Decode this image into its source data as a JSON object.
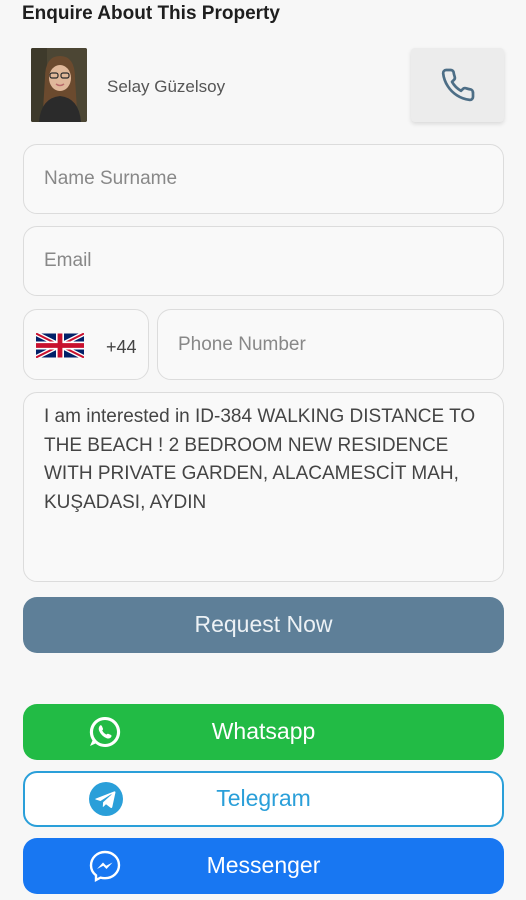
{
  "form": {
    "title": "Enquire About This Property"
  },
  "agent": {
    "name": "Selay Güzelsoy",
    "avatar_icon": "agent-photo",
    "call_icon": "phone-icon"
  },
  "fields": {
    "name_placeholder": "Name Surname",
    "email_placeholder": "Email",
    "country_flag_icon": "uk-flag-icon",
    "dial_code": "+44",
    "phone_placeholder": "Phone Number",
    "message_value": "I am interested in ID-384 WALKING DISTANCE TO THE BEACH ! 2 BEDROOM NEW RESIDENCE WITH PRIVATE GARDEN, ALACAMESCİT MAH, KUŞADASI, AYDIN"
  },
  "buttons": {
    "request_label": "Request Now",
    "whatsapp_label": "Whatsapp",
    "telegram_label": "Telegram",
    "messenger_label": "Messenger"
  },
  "colors": {
    "request": "#5e7f98",
    "whatsapp": "#22bb45",
    "telegram": "#2a9fd9",
    "messenger": "#1877f2",
    "phone_icon": "#4d6e86"
  }
}
